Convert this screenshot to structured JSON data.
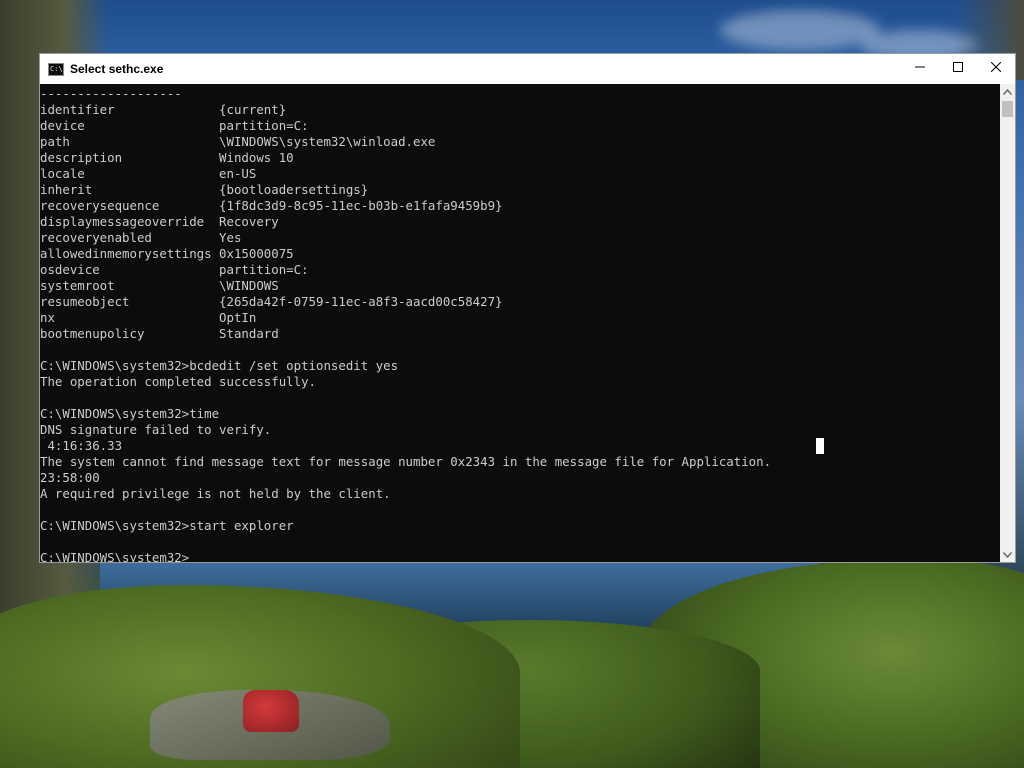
{
  "window": {
    "title": "Select sethc.exe",
    "icon_text": "C:\\",
    "controls": [
      "minimize-icon",
      "maximize-icon",
      "close-icon"
    ]
  },
  "terminal": {
    "lines": [
      "-------------------",
      "identifier              {current}",
      "device                  partition=C:",
      "path                    \\WINDOWS\\system32\\winload.exe",
      "description             Windows 10",
      "locale                  en-US",
      "inherit                 {bootloadersettings}",
      "recoverysequence        {1f8dc3d9-8c95-11ec-b03b-e1fafa9459b9}",
      "displaymessageoverride  Recovery",
      "recoveryenabled         Yes",
      "allowedinmemorysettings 0x15000075",
      "osdevice                partition=C:",
      "systemroot              \\WINDOWS",
      "resumeobject            {265da42f-0759-11ec-a8f3-aacd00c58427}",
      "nx                      OptIn",
      "bootmenupolicy          Standard",
      "",
      "C:\\WINDOWS\\system32>bcdedit /set optionsedit yes",
      "The operation completed successfully.",
      "",
      "C:\\WINDOWS\\system32>time",
      "DNS signature failed to verify.",
      " 4:16:36.33",
      "The system cannot find message text for message number 0x2343 in the message file for Application.",
      "23:58:00",
      "A required privilege is not held by the client.",
      "",
      "C:\\WINDOWS\\system32>start explorer",
      "",
      "C:\\WINDOWS\\system32>"
    ]
  }
}
